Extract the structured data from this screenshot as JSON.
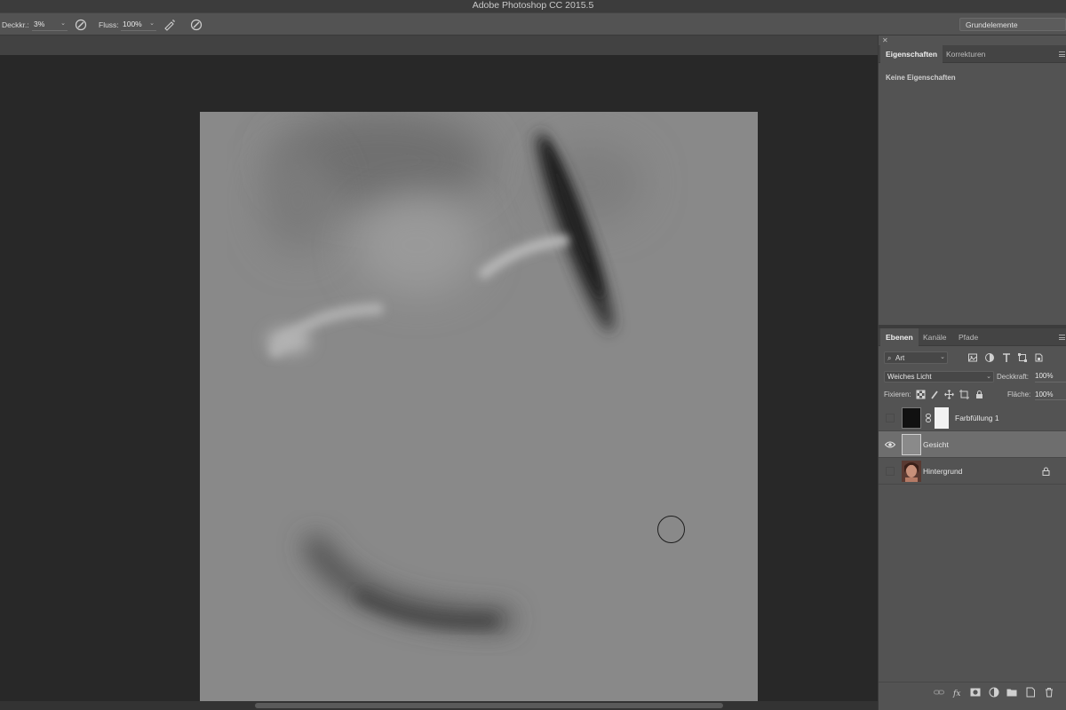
{
  "app": {
    "title": "Adobe Photoshop CC 2015.5"
  },
  "options_bar": {
    "opacity_label": "Deckkr.:",
    "opacity_value": "3%",
    "flow_label": "Fluss:",
    "flow_value": "100%",
    "workspace_value": "Grundelemente"
  },
  "properties_panel": {
    "tabs": [
      {
        "label": "Eigenschaften",
        "active": true
      },
      {
        "label": "Korrekturen",
        "active": false
      }
    ],
    "empty_text": "Keine Eigenschaften"
  },
  "layers_panel": {
    "tabs": [
      {
        "label": "Ebenen",
        "active": true
      },
      {
        "label": "Kanäle",
        "active": false
      },
      {
        "label": "Pfade",
        "active": false
      }
    ],
    "filter_kind": "Art",
    "blend_mode": "Weiches Licht",
    "opacity_label": "Deckkraft:",
    "opacity_value": "100%",
    "lock_label": "Fixieren:",
    "fill_label": "Fläche:",
    "fill_value": "100%",
    "layers": [
      {
        "name": "Farbfüllung 1",
        "visible": false,
        "selected": false,
        "locked": false
      },
      {
        "name": "Gesicht",
        "visible": true,
        "selected": true,
        "locked": false
      },
      {
        "name": "Hintergrund",
        "visible": false,
        "selected": false,
        "locked": true
      }
    ]
  },
  "colors": {
    "document_gray": "#8a8a8a",
    "panel": "#535353",
    "canvas_bg": "#282828",
    "selected_layer": "#6e6e6e"
  }
}
